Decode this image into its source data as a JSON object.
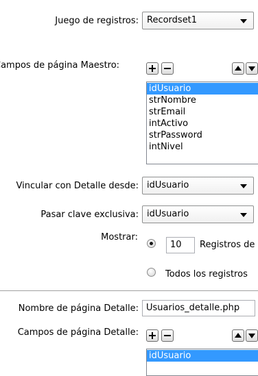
{
  "recordset": {
    "label": "Juego de registros:",
    "value": "Recordset1"
  },
  "master_fields": {
    "label": "Campos de página Maestro:",
    "items": [
      "idUsuario",
      "strNombre",
      "strEmail",
      "intActivo",
      "strPassword",
      "intNivel"
    ],
    "selected": 0
  },
  "link_detail": {
    "label": "Vincular con Detalle desde:",
    "value": "idUsuario"
  },
  "unique_key": {
    "label": "Pasar clave exclusiva:",
    "value": "idUsuario"
  },
  "show": {
    "label": "Mostrar:",
    "records_count": "10",
    "records_label": "Registros de",
    "all_label": "Todos los registros"
  },
  "detail_page": {
    "label": "Nombre de página Detalle:",
    "value": "Usuarios_detalle.php"
  },
  "detail_fields": {
    "label": "Campos de página Detalle:",
    "items": [
      "idUsuario"
    ],
    "selected": 0
  },
  "icons": [
    "plus-icon",
    "minus-icon",
    "arrow-up-icon",
    "arrow-down-icon",
    "chevron-down-icon",
    "radio-icon"
  ]
}
